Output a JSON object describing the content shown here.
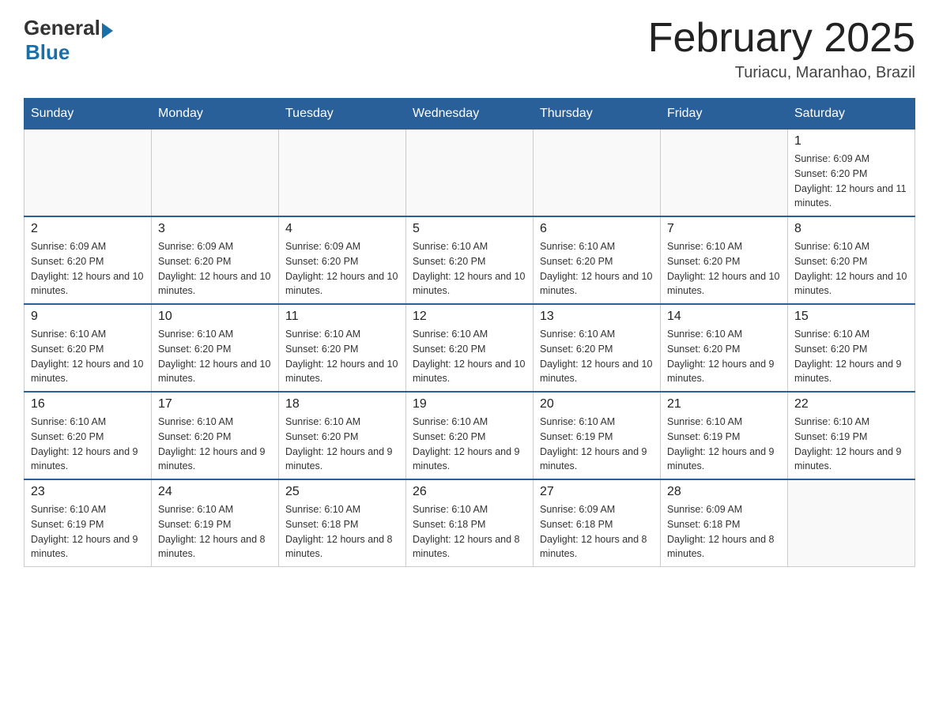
{
  "header": {
    "logo_general": "General",
    "logo_blue": "Blue",
    "month_year": "February 2025",
    "location": "Turiacu, Maranhao, Brazil"
  },
  "weekdays": [
    "Sunday",
    "Monday",
    "Tuesday",
    "Wednesday",
    "Thursday",
    "Friday",
    "Saturday"
  ],
  "weeks": [
    [
      {
        "day": "",
        "info": ""
      },
      {
        "day": "",
        "info": ""
      },
      {
        "day": "",
        "info": ""
      },
      {
        "day": "",
        "info": ""
      },
      {
        "day": "",
        "info": ""
      },
      {
        "day": "",
        "info": ""
      },
      {
        "day": "1",
        "info": "Sunrise: 6:09 AM\nSunset: 6:20 PM\nDaylight: 12 hours and 11 minutes."
      }
    ],
    [
      {
        "day": "2",
        "info": "Sunrise: 6:09 AM\nSunset: 6:20 PM\nDaylight: 12 hours and 10 minutes."
      },
      {
        "day": "3",
        "info": "Sunrise: 6:09 AM\nSunset: 6:20 PM\nDaylight: 12 hours and 10 minutes."
      },
      {
        "day": "4",
        "info": "Sunrise: 6:09 AM\nSunset: 6:20 PM\nDaylight: 12 hours and 10 minutes."
      },
      {
        "day": "5",
        "info": "Sunrise: 6:10 AM\nSunset: 6:20 PM\nDaylight: 12 hours and 10 minutes."
      },
      {
        "day": "6",
        "info": "Sunrise: 6:10 AM\nSunset: 6:20 PM\nDaylight: 12 hours and 10 minutes."
      },
      {
        "day": "7",
        "info": "Sunrise: 6:10 AM\nSunset: 6:20 PM\nDaylight: 12 hours and 10 minutes."
      },
      {
        "day": "8",
        "info": "Sunrise: 6:10 AM\nSunset: 6:20 PM\nDaylight: 12 hours and 10 minutes."
      }
    ],
    [
      {
        "day": "9",
        "info": "Sunrise: 6:10 AM\nSunset: 6:20 PM\nDaylight: 12 hours and 10 minutes."
      },
      {
        "day": "10",
        "info": "Sunrise: 6:10 AM\nSunset: 6:20 PM\nDaylight: 12 hours and 10 minutes."
      },
      {
        "day": "11",
        "info": "Sunrise: 6:10 AM\nSunset: 6:20 PM\nDaylight: 12 hours and 10 minutes."
      },
      {
        "day": "12",
        "info": "Sunrise: 6:10 AM\nSunset: 6:20 PM\nDaylight: 12 hours and 10 minutes."
      },
      {
        "day": "13",
        "info": "Sunrise: 6:10 AM\nSunset: 6:20 PM\nDaylight: 12 hours and 10 minutes."
      },
      {
        "day": "14",
        "info": "Sunrise: 6:10 AM\nSunset: 6:20 PM\nDaylight: 12 hours and 9 minutes."
      },
      {
        "day": "15",
        "info": "Sunrise: 6:10 AM\nSunset: 6:20 PM\nDaylight: 12 hours and 9 minutes."
      }
    ],
    [
      {
        "day": "16",
        "info": "Sunrise: 6:10 AM\nSunset: 6:20 PM\nDaylight: 12 hours and 9 minutes."
      },
      {
        "day": "17",
        "info": "Sunrise: 6:10 AM\nSunset: 6:20 PM\nDaylight: 12 hours and 9 minutes."
      },
      {
        "day": "18",
        "info": "Sunrise: 6:10 AM\nSunset: 6:20 PM\nDaylight: 12 hours and 9 minutes."
      },
      {
        "day": "19",
        "info": "Sunrise: 6:10 AM\nSunset: 6:20 PM\nDaylight: 12 hours and 9 minutes."
      },
      {
        "day": "20",
        "info": "Sunrise: 6:10 AM\nSunset: 6:19 PM\nDaylight: 12 hours and 9 minutes."
      },
      {
        "day": "21",
        "info": "Sunrise: 6:10 AM\nSunset: 6:19 PM\nDaylight: 12 hours and 9 minutes."
      },
      {
        "day": "22",
        "info": "Sunrise: 6:10 AM\nSunset: 6:19 PM\nDaylight: 12 hours and 9 minutes."
      }
    ],
    [
      {
        "day": "23",
        "info": "Sunrise: 6:10 AM\nSunset: 6:19 PM\nDaylight: 12 hours and 9 minutes."
      },
      {
        "day": "24",
        "info": "Sunrise: 6:10 AM\nSunset: 6:19 PM\nDaylight: 12 hours and 8 minutes."
      },
      {
        "day": "25",
        "info": "Sunrise: 6:10 AM\nSunset: 6:18 PM\nDaylight: 12 hours and 8 minutes."
      },
      {
        "day": "26",
        "info": "Sunrise: 6:10 AM\nSunset: 6:18 PM\nDaylight: 12 hours and 8 minutes."
      },
      {
        "day": "27",
        "info": "Sunrise: 6:09 AM\nSunset: 6:18 PM\nDaylight: 12 hours and 8 minutes."
      },
      {
        "day": "28",
        "info": "Sunrise: 6:09 AM\nSunset: 6:18 PM\nDaylight: 12 hours and 8 minutes."
      },
      {
        "day": "",
        "info": ""
      }
    ]
  ]
}
